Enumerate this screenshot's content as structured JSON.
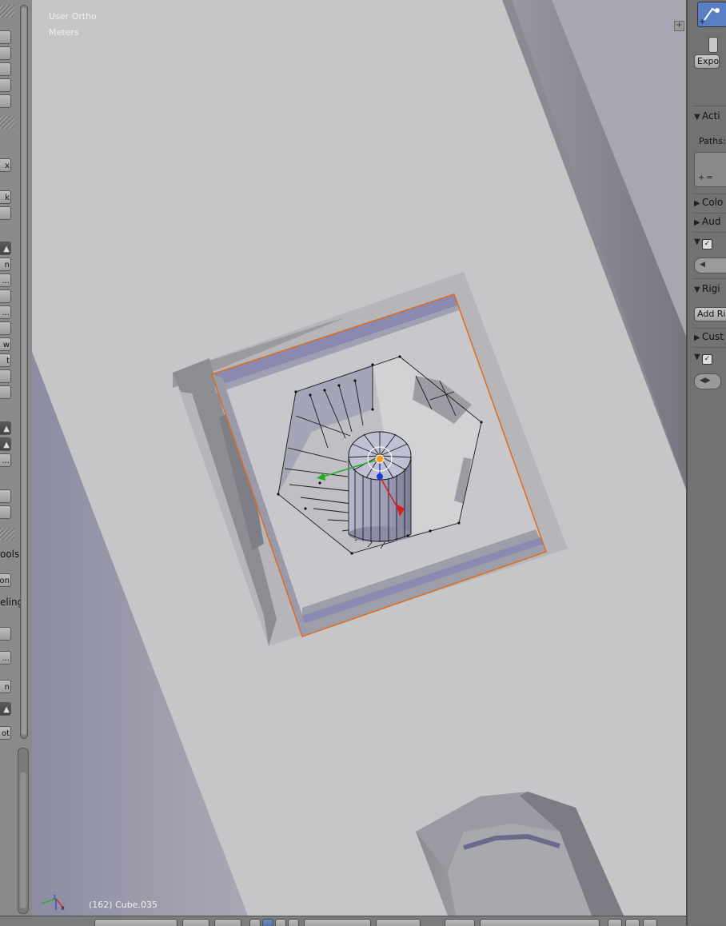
{
  "viewport": {
    "view_name": "User Ortho",
    "units": "Meters",
    "object_info": "(162) Cube.035"
  },
  "tool_shelf": {
    "label_tools": "ools",
    "label_modeling": "eling",
    "btn_x": "x",
    "btn_k": "k",
    "btn_n1": "n",
    "btn_ell1": "...",
    "btn_ell2": "...",
    "btn_w": "w",
    "btn_t": "t",
    "btn_ell3": "...",
    "btn_on": "on",
    "btn_ell4": "...",
    "btn_n2": "n",
    "btn_ot": "ot"
  },
  "properties": {
    "expo_label": "Expo",
    "active_label": "Acti",
    "paths_label": "Paths:",
    "color_label": "Colo",
    "audio_label": "Aud",
    "rigid_label": "Rigi",
    "add_rigid_label": "Add Rig",
    "custom_label": "Cust"
  },
  "colors": {
    "viewport_bg": "#a7a7b1",
    "floor": "#c6c6c9",
    "selection_edge": "#e06a1e",
    "manip_x": "#d81e1e",
    "manip_y": "#22b022",
    "manip_z": "#1e3ad8",
    "pivot": "#ff9a1a"
  }
}
